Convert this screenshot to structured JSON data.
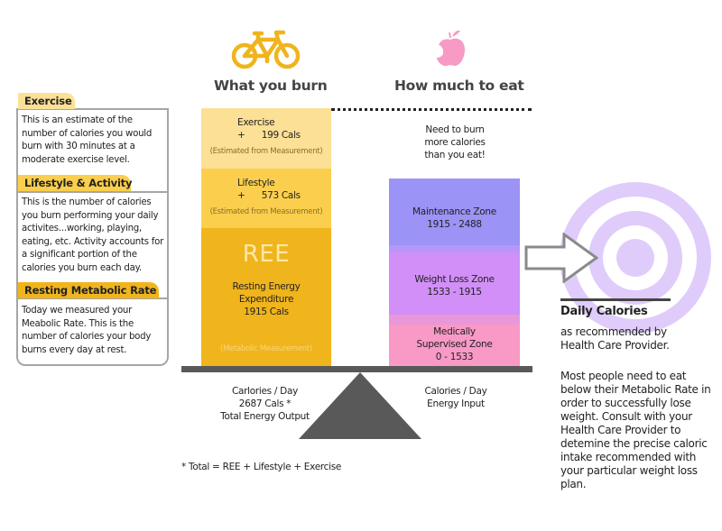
{
  "headers": {
    "burn": "What you burn",
    "eat": "How much to eat"
  },
  "icons": {
    "burn": "bicycle-icon",
    "eat": "apple-icon"
  },
  "colors": {
    "bicycle": "#f0b41c",
    "apple": "#f79ac4",
    "exercise": "#fce096",
    "lifestyle": "#fbcf4d",
    "ree": "#f0b41c",
    "maintenance": "#9b93f5",
    "weight_loss": "#d18ff7",
    "medical": "#f899c6",
    "target": "#dfccfb",
    "beam": "#595959"
  },
  "info_panel": {
    "sections": [
      {
        "title": "Exercise",
        "text": "This is an estimate of the number of calories you would burn with 30 minutes at a moderate exercise level."
      },
      {
        "title": "Lifestyle & Activity",
        "text": "This is the number of calories you burn performing your daily activites...working, playing, eating, etc.  Activity accounts for a significant portion of the calories you burn each day."
      },
      {
        "title": "Resting Metabolic Rate",
        "text": "Today we measured your Meabolic Rate.  This is the number of calories your body burns every day at rest."
      }
    ]
  },
  "burn_bar": {
    "exercise": {
      "label": "Exercise",
      "value": "+      199 Cals",
      "note": "(Estimated from Measurement)"
    },
    "lifestyle": {
      "label": "Lifestyle",
      "value": "+      573 Cals",
      "note": "(Estimated from Measurement)"
    },
    "ree": {
      "big": "REE",
      "line1": "Resting Energy",
      "line2": "Expenditure",
      "line3": "1915 Cals",
      "note": "(Metabolic Measurement)"
    }
  },
  "eat_bar": {
    "message": [
      "Need to burn",
      "more calories",
      "than you eat!"
    ],
    "zones": [
      {
        "name": "Maintenance Zone",
        "range": "1915 - 2488"
      },
      {
        "name": "Weight Loss Zone",
        "range": "1533 - 1915"
      },
      {
        "name1": "Medically",
        "name2": "Supervised Zone",
        "range": "0 - 1533"
      }
    ]
  },
  "captions": {
    "left": [
      "Carlories / Day",
      "2687 Cals *",
      "Total Energy Output"
    ],
    "right": [
      "Calories / Day",
      "Energy Input"
    ],
    "footnote": "* Total = REE + Lifestyle + Exercise"
  },
  "target_panel": {
    "title": "Daily Calories",
    "subtitle1": "as recommended by",
    "subtitle2": "Health Care Provider.",
    "body": "Most people need to eat below their Metabolic Rate in order to successfully lose weight.  Consult with your Health Care Provider to detemine the precise caloric intake recommended with your particular weight loss plan."
  }
}
